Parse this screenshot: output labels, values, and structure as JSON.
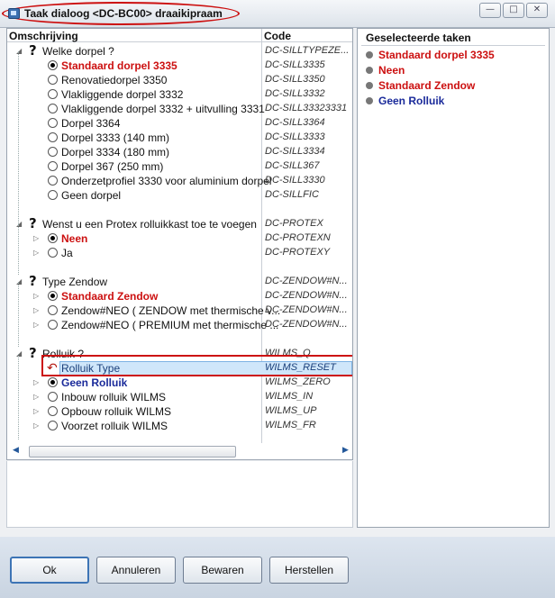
{
  "window": {
    "title": "Taak dialoog <DC-BC00> draaikipraam",
    "minimize_glyph": "—",
    "maximize_glyph": "□",
    "close_glyph": "✕"
  },
  "tree": {
    "col_description": "Omschrijving",
    "col_code": "Code",
    "groups": [
      {
        "question": "Welke dorpel ?",
        "code": "DC-SILLTYPEZE...",
        "options": [
          {
            "label": "Standaard dorpel 3335",
            "code": "DC-SILL3335",
            "selected": true,
            "style": "red"
          },
          {
            "label": "Renovatiedorpel 3350",
            "code": "DC-SILL3350"
          },
          {
            "label": "Vlakliggende dorpel 3332",
            "code": "DC-SILL3332"
          },
          {
            "label": "Vlakliggende dorpel 3332 + uitvulling 3331",
            "code": "DC-SILL33323331"
          },
          {
            "label": "Dorpel 3364",
            "code": "DC-SILL3364"
          },
          {
            "label": "Dorpel 3333 (140 mm)",
            "code": "DC-SILL3333"
          },
          {
            "label": "Dorpel 3334 (180 mm)",
            "code": "DC-SILL3334"
          },
          {
            "label": "Dorpel 367 (250 mm)",
            "code": "DC-SILL367"
          },
          {
            "label": "Onderzetprofiel 3330 voor aluminium dorpel",
            "code": "DC-SILL3330"
          },
          {
            "label": "Geen dorpel",
            "code": "DC-SILLFIC"
          }
        ]
      },
      {
        "question": "Wenst u een Protex rolluikkast toe te voegen",
        "code": "DC-PROTEX",
        "options": [
          {
            "label": "Neen",
            "code": "DC-PROTEXN",
            "selected": true,
            "style": "red"
          },
          {
            "label": "Ja",
            "code": "DC-PROTEXY"
          }
        ]
      },
      {
        "question": "Type Zendow",
        "code": "DC-ZENDOW#N...",
        "options": [
          {
            "label": "Standaard Zendow",
            "code": "DC-ZENDOW#N...",
            "selected": true,
            "style": "red"
          },
          {
            "label": "Zendow#NEO ( ZENDOW met thermische v...",
            "code": "DC-ZENDOW#N..."
          },
          {
            "label": "Zendow#NEO ( PREMIUM met thermische ...",
            "code": "DC-ZENDOW#N..."
          }
        ]
      },
      {
        "question": "Rolluik ?",
        "code": "WILMS_Q",
        "options": [
          {
            "label": "Rolluik Type",
            "code": "WILMS_RESET",
            "highlight": true
          },
          {
            "label": "Geen Rolluik",
            "code": "WILMS_ZERO",
            "selected": true,
            "style": "blue"
          },
          {
            "label": "Inbouw rolluik WILMS",
            "code": "WILMS_IN"
          },
          {
            "label": "Opbouw rolluik WILMS",
            "code": "WILMS_UP"
          },
          {
            "label": "Voorzet rolluik WILMS",
            "code": "WILMS_FR"
          }
        ]
      }
    ]
  },
  "selected_panel": {
    "title": "Geselecteerde taken",
    "items": [
      {
        "label": "Standaard dorpel 3335",
        "style": "red"
      },
      {
        "label": "Neen",
        "style": "red"
      },
      {
        "label": "Standaard Zendow",
        "style": "red"
      },
      {
        "label": "Geen Rolluik",
        "style": "blue"
      }
    ]
  },
  "buttons": {
    "ok": "Ok",
    "cancel": "Annuleren",
    "save": "Bewaren",
    "restore": "Herstellen"
  },
  "colors": {
    "accent_red": "#cc1010",
    "accent_blue": "#1a2a9a",
    "highlight": "#cfe6fa"
  }
}
